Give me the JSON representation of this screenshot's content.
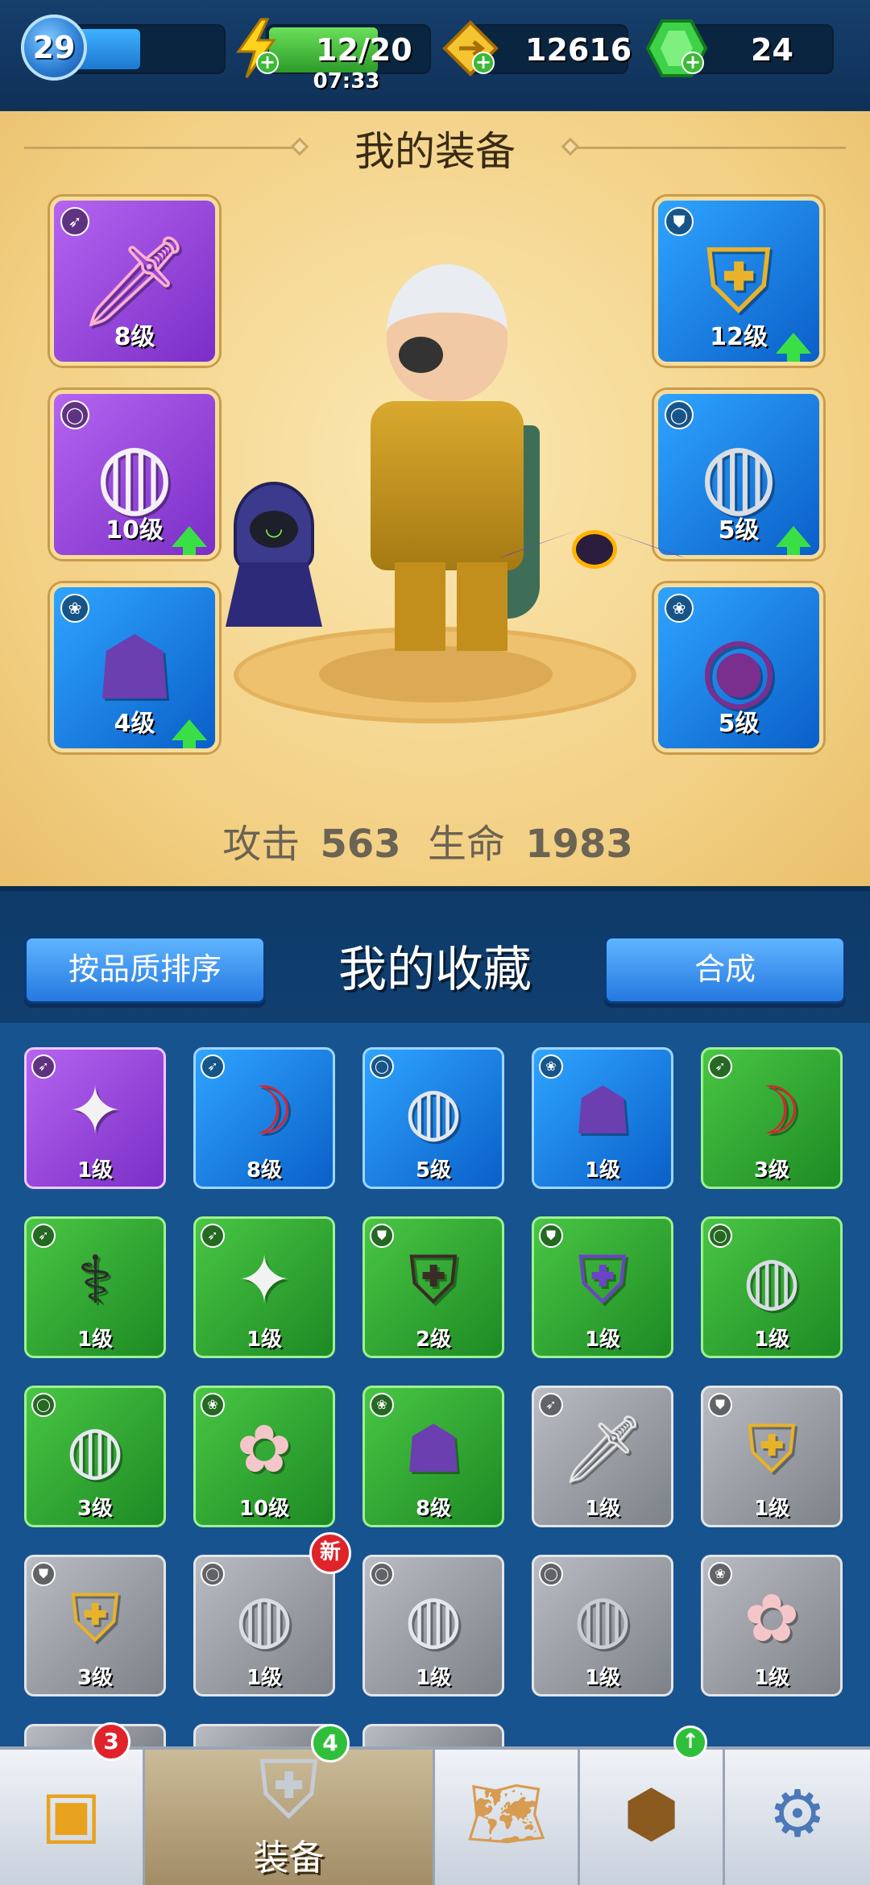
{
  "hud": {
    "player_level": "29",
    "energy": "12/20",
    "energy_timer": "07:33",
    "gold": "12616",
    "gems": "24"
  },
  "equipment": {
    "title": "我的装备",
    "left_slots": [
      {
        "name": "pink-sword",
        "level": "8级",
        "rarity": "purple",
        "type_icon": "bow-type-icon",
        "upgrade": false
      },
      {
        "name": "eagle-ring",
        "level": "10级",
        "rarity": "purple",
        "type_icon": "ring-type-icon",
        "upgrade": true
      },
      {
        "name": "reaper-pet",
        "level": "4级",
        "rarity": "blue",
        "type_icon": "paw-type-icon",
        "upgrade": true
      }
    ],
    "right_slots": [
      {
        "name": "golden-armor",
        "level": "12级",
        "rarity": "blue",
        "type_icon": "armor-type-icon",
        "upgrade": true
      },
      {
        "name": "bear-ring",
        "level": "5级",
        "rarity": "blue",
        "type_icon": "ring-type-icon",
        "upgrade": true
      },
      {
        "name": "bat-pet",
        "level": "5级",
        "rarity": "blue",
        "type_icon": "paw-type-icon",
        "upgrade": false
      }
    ],
    "stats": {
      "attack_label": "攻击",
      "attack_value": "563",
      "hp_label": "生命",
      "hp_value": "1983"
    }
  },
  "collection": {
    "sort_button": "按品质排序",
    "title": "我的收藏",
    "merge_button": "合成",
    "new_badge": "新",
    "items": [
      {
        "name": "shuriken",
        "level": "1级",
        "rarity": "purple"
      },
      {
        "name": "red-bow",
        "level": "8级",
        "rarity": "blue"
      },
      {
        "name": "wolf-ring",
        "level": "5级",
        "rarity": "blue"
      },
      {
        "name": "reaper-pet",
        "level": "1级",
        "rarity": "blue"
      },
      {
        "name": "red-bow",
        "level": "3级",
        "rarity": "green"
      },
      {
        "name": "scythe",
        "level": "1级",
        "rarity": "green"
      },
      {
        "name": "shuriken",
        "level": "1级",
        "rarity": "green"
      },
      {
        "name": "leather-armor",
        "level": "2级",
        "rarity": "green"
      },
      {
        "name": "mage-robe",
        "level": "1级",
        "rarity": "green"
      },
      {
        "name": "bear-ring",
        "level": "1级",
        "rarity": "green"
      },
      {
        "name": "eagle-ring",
        "level": "3级",
        "rarity": "green"
      },
      {
        "name": "fairy-pet",
        "level": "10级",
        "rarity": "green"
      },
      {
        "name": "reaper-pet",
        "level": "8级",
        "rarity": "green"
      },
      {
        "name": "jagged-sword",
        "level": "1级",
        "rarity": "gray"
      },
      {
        "name": "golden-armor",
        "level": "1级",
        "rarity": "gray"
      },
      {
        "name": "golden-armor",
        "level": "3级",
        "rarity": "gray"
      },
      {
        "name": "bear-ring",
        "level": "1级",
        "rarity": "gray"
      },
      {
        "name": "wolf-ring",
        "level": "1级",
        "rarity": "gray"
      },
      {
        "name": "snake-ring",
        "level": "1级",
        "rarity": "gray"
      },
      {
        "name": "fairy-pet",
        "level": "1级",
        "rarity": "gray"
      }
    ]
  },
  "nav": {
    "shop_badge": "3",
    "equip_badge": "4",
    "equip_label": "装备"
  }
}
